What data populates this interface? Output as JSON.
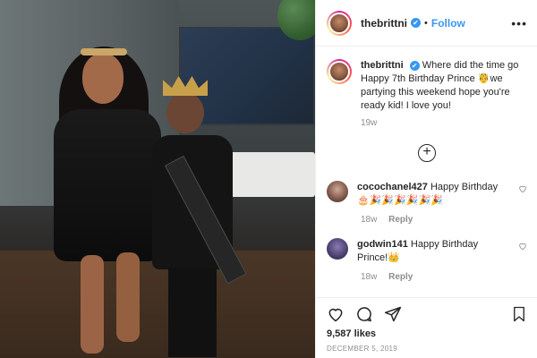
{
  "post": {
    "username": "thebrittni",
    "verified_mark": "✔",
    "separator": "•",
    "follow_label": "Follow",
    "more_label": "•••",
    "caption_user": "thebrittni",
    "caption_text": "Where did the time go Happy 7th Birthday Prince 🤴we partying this weekend hope you're ready kid! I love you!",
    "caption_age": "19w",
    "load_more_label": "+",
    "likes": "9,587 likes",
    "date": "DECEMBER 5, 2019"
  },
  "comments": [
    {
      "user": "cocochanel427",
      "text": "Happy Birthday 🎂🎉🎉🎉🎉🎉🎉",
      "age": "18w",
      "reply_label": "Reply"
    },
    {
      "user": "godwin141",
      "text": "Happy Birthday Prince!👑",
      "age": "18w",
      "reply_label": "Reply"
    }
  ],
  "icons": {
    "like": "heart-icon",
    "comment": "comment-icon",
    "share": "share-icon",
    "save": "bookmark-icon",
    "options": "more-options-icon"
  },
  "colors": {
    "accent": "#3897f0",
    "text": "#262626",
    "muted": "#8e8e8e",
    "border": "#efefef"
  }
}
